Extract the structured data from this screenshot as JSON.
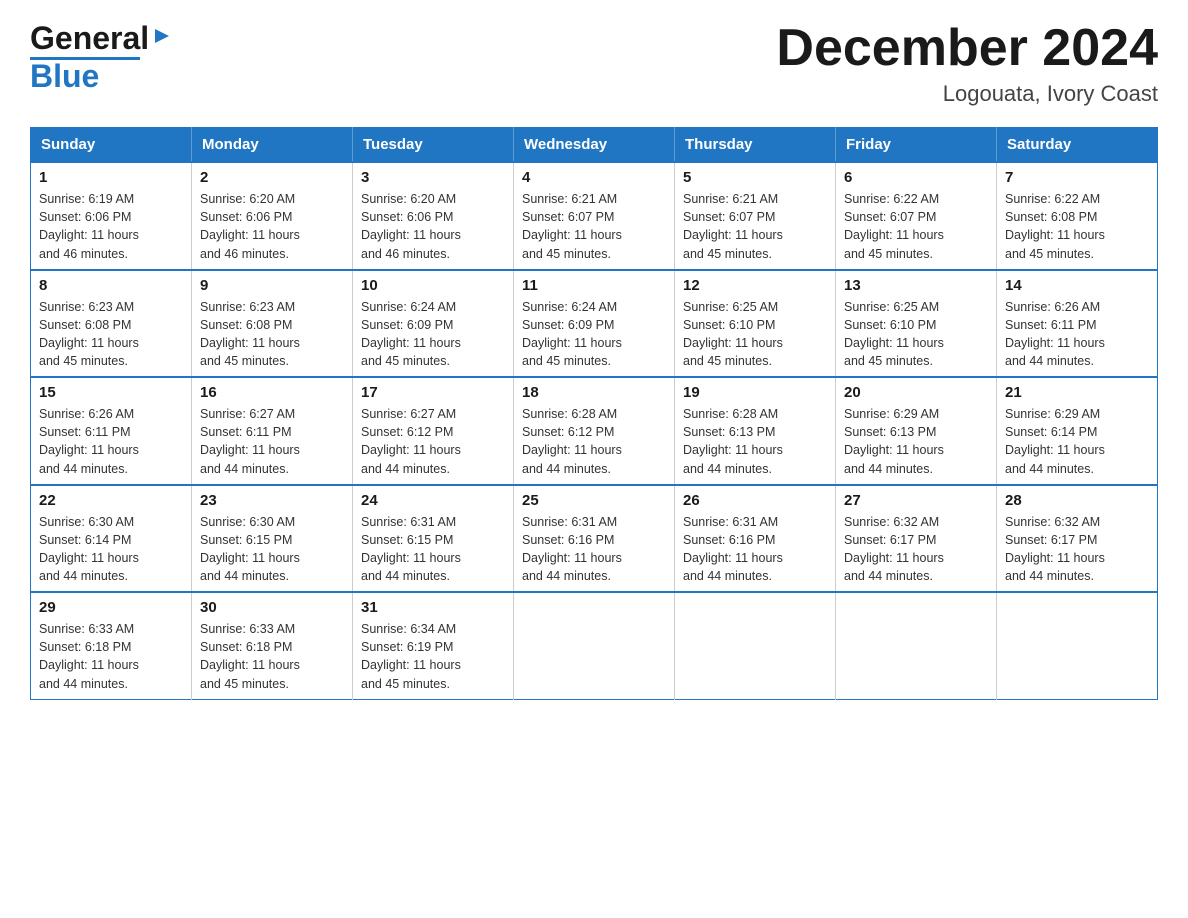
{
  "logo": {
    "general": "General",
    "triangle": "▶",
    "blue": "Blue"
  },
  "title": "December 2024",
  "subtitle": "Logouata, Ivory Coast",
  "days_of_week": [
    "Sunday",
    "Monday",
    "Tuesday",
    "Wednesday",
    "Thursday",
    "Friday",
    "Saturday"
  ],
  "weeks": [
    [
      {
        "day": "1",
        "sunrise": "6:19 AM",
        "sunset": "6:06 PM",
        "daylight": "11 hours and 46 minutes."
      },
      {
        "day": "2",
        "sunrise": "6:20 AM",
        "sunset": "6:06 PM",
        "daylight": "11 hours and 46 minutes."
      },
      {
        "day": "3",
        "sunrise": "6:20 AM",
        "sunset": "6:06 PM",
        "daylight": "11 hours and 46 minutes."
      },
      {
        "day": "4",
        "sunrise": "6:21 AM",
        "sunset": "6:07 PM",
        "daylight": "11 hours and 45 minutes."
      },
      {
        "day": "5",
        "sunrise": "6:21 AM",
        "sunset": "6:07 PM",
        "daylight": "11 hours and 45 minutes."
      },
      {
        "day": "6",
        "sunrise": "6:22 AM",
        "sunset": "6:07 PM",
        "daylight": "11 hours and 45 minutes."
      },
      {
        "day": "7",
        "sunrise": "6:22 AM",
        "sunset": "6:08 PM",
        "daylight": "11 hours and 45 minutes."
      }
    ],
    [
      {
        "day": "8",
        "sunrise": "6:23 AM",
        "sunset": "6:08 PM",
        "daylight": "11 hours and 45 minutes."
      },
      {
        "day": "9",
        "sunrise": "6:23 AM",
        "sunset": "6:08 PM",
        "daylight": "11 hours and 45 minutes."
      },
      {
        "day": "10",
        "sunrise": "6:24 AM",
        "sunset": "6:09 PM",
        "daylight": "11 hours and 45 minutes."
      },
      {
        "day": "11",
        "sunrise": "6:24 AM",
        "sunset": "6:09 PM",
        "daylight": "11 hours and 45 minutes."
      },
      {
        "day": "12",
        "sunrise": "6:25 AM",
        "sunset": "6:10 PM",
        "daylight": "11 hours and 45 minutes."
      },
      {
        "day": "13",
        "sunrise": "6:25 AM",
        "sunset": "6:10 PM",
        "daylight": "11 hours and 45 minutes."
      },
      {
        "day": "14",
        "sunrise": "6:26 AM",
        "sunset": "6:11 PM",
        "daylight": "11 hours and 44 minutes."
      }
    ],
    [
      {
        "day": "15",
        "sunrise": "6:26 AM",
        "sunset": "6:11 PM",
        "daylight": "11 hours and 44 minutes."
      },
      {
        "day": "16",
        "sunrise": "6:27 AM",
        "sunset": "6:11 PM",
        "daylight": "11 hours and 44 minutes."
      },
      {
        "day": "17",
        "sunrise": "6:27 AM",
        "sunset": "6:12 PM",
        "daylight": "11 hours and 44 minutes."
      },
      {
        "day": "18",
        "sunrise": "6:28 AM",
        "sunset": "6:12 PM",
        "daylight": "11 hours and 44 minutes."
      },
      {
        "day": "19",
        "sunrise": "6:28 AM",
        "sunset": "6:13 PM",
        "daylight": "11 hours and 44 minutes."
      },
      {
        "day": "20",
        "sunrise": "6:29 AM",
        "sunset": "6:13 PM",
        "daylight": "11 hours and 44 minutes."
      },
      {
        "day": "21",
        "sunrise": "6:29 AM",
        "sunset": "6:14 PM",
        "daylight": "11 hours and 44 minutes."
      }
    ],
    [
      {
        "day": "22",
        "sunrise": "6:30 AM",
        "sunset": "6:14 PM",
        "daylight": "11 hours and 44 minutes."
      },
      {
        "day": "23",
        "sunrise": "6:30 AM",
        "sunset": "6:15 PM",
        "daylight": "11 hours and 44 minutes."
      },
      {
        "day": "24",
        "sunrise": "6:31 AM",
        "sunset": "6:15 PM",
        "daylight": "11 hours and 44 minutes."
      },
      {
        "day": "25",
        "sunrise": "6:31 AM",
        "sunset": "6:16 PM",
        "daylight": "11 hours and 44 minutes."
      },
      {
        "day": "26",
        "sunrise": "6:31 AM",
        "sunset": "6:16 PM",
        "daylight": "11 hours and 44 minutes."
      },
      {
        "day": "27",
        "sunrise": "6:32 AM",
        "sunset": "6:17 PM",
        "daylight": "11 hours and 44 minutes."
      },
      {
        "day": "28",
        "sunrise": "6:32 AM",
        "sunset": "6:17 PM",
        "daylight": "11 hours and 44 minutes."
      }
    ],
    [
      {
        "day": "29",
        "sunrise": "6:33 AM",
        "sunset": "6:18 PM",
        "daylight": "11 hours and 44 minutes."
      },
      {
        "day": "30",
        "sunrise": "6:33 AM",
        "sunset": "6:18 PM",
        "daylight": "11 hours and 45 minutes."
      },
      {
        "day": "31",
        "sunrise": "6:34 AM",
        "sunset": "6:19 PM",
        "daylight": "11 hours and 45 minutes."
      },
      null,
      null,
      null,
      null
    ]
  ],
  "labels": {
    "sunrise": "Sunrise:",
    "sunset": "Sunset:",
    "daylight": "Daylight:"
  }
}
